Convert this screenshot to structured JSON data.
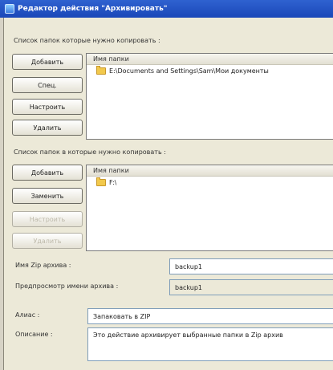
{
  "window": {
    "title": "Редактор действия \"Архивировать\""
  },
  "source": {
    "label": "Список папок которые нужно копировать :",
    "buttons": {
      "add": "Добавить",
      "special": "Спец.",
      "configure": "Настроить",
      "remove": "Удалить"
    },
    "column": "Имя папки",
    "items": [
      "E:\\Documents and Settings\\Sam\\Мои документы"
    ]
  },
  "target": {
    "label": "Список папок в которые нужно копировать :",
    "buttons": {
      "add": "Добавить",
      "change": "Заменить",
      "configure": "Настроить",
      "remove": "Удалить"
    },
    "column": "Имя папки",
    "items": [
      "F:\\"
    ]
  },
  "fields": {
    "zip_name": {
      "label": "Имя Zip архива :",
      "value": "backup1"
    },
    "preview": {
      "label": "Предпросмотр имени архива :",
      "value": "backup1"
    },
    "alias": {
      "label": "Алиас :",
      "value": "Запаковать в ZIP"
    },
    "description": {
      "label": "Описание :",
      "value": "Это действие архивирует выбранные папки в Zip архив"
    }
  }
}
